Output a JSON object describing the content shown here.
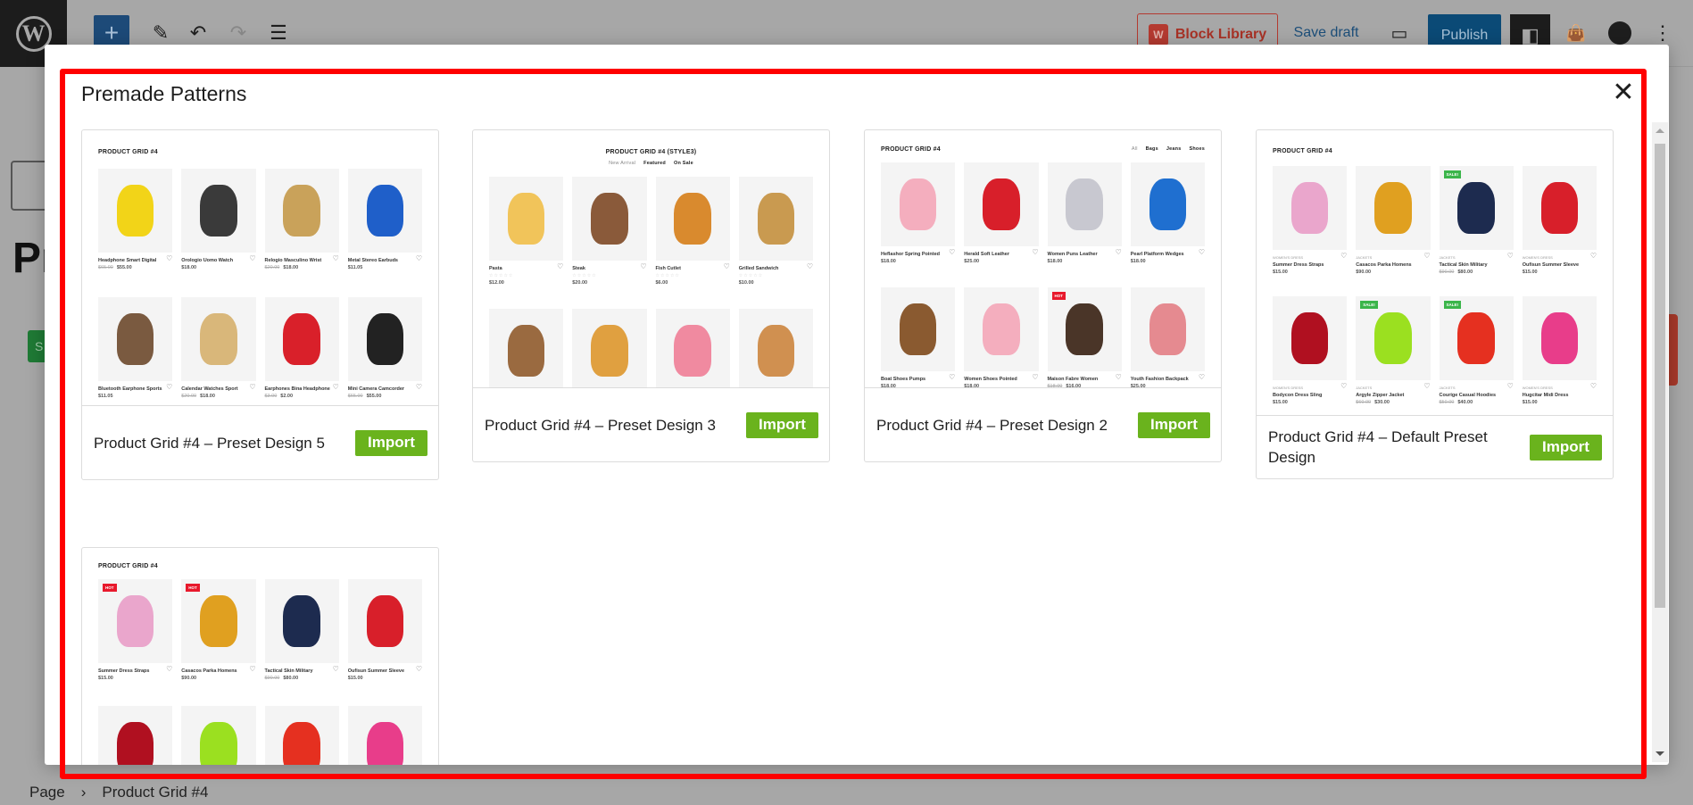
{
  "topbar": {
    "add_icon": "plus-icon",
    "block_library_label": "Block Library",
    "save_draft_label": "Save draft",
    "publish_label": "Publish"
  },
  "background": {
    "heading_fragment": "Pr",
    "green_button_fragment": "S"
  },
  "breadcrumb": {
    "items": [
      "Page",
      "Product Grid #4"
    ]
  },
  "modal": {
    "title": "Premade Patterns",
    "close_icon": "close-icon",
    "cards": [
      {
        "label": "Product Grid #4 – Preset Design 5",
        "import_label": "Import",
        "preview": {
          "heading": "PRODUCT GRID #4",
          "tabs": [],
          "stars": false,
          "products": [
            {
              "name": "Headphone Smart Digital",
              "old_price": "$65.00",
              "price": "$55.00",
              "color": "#f2d418"
            },
            {
              "name": "Orologio Uomo Watch",
              "price": "$18.00",
              "color": "#3a3a3a"
            },
            {
              "name": "Relogio Masculino Wrist",
              "old_price": "$20.00",
              "price": "$18.00",
              "color": "#c9a25a"
            },
            {
              "name": "Metal Stereo Earbuds",
              "price": "$11.05",
              "color": "#1f5fc9"
            },
            {
              "name": "Bluetooth Earphone Sports",
              "price": "$11.05",
              "color": "#7a5a40"
            },
            {
              "name": "Calendar Watches Sport",
              "old_price": "$20.00",
              "price": "$18.00",
              "color": "#d9b77a"
            },
            {
              "name": "Earphones Bina Headphone",
              "old_price": "$3.00",
              "price": "$2.00",
              "color": "#d9202a"
            },
            {
              "name": "Mini Camera Camcorder",
              "old_price": "$65.00",
              "price": "$55.00",
              "color": "#222222"
            }
          ]
        }
      },
      {
        "label": "Product Grid #4 – Preset Design 3",
        "import_label": "Import",
        "preview": {
          "heading": "PRODUCT GRID #4 (STYLE3)",
          "tabs": [
            "New Arrival",
            "Featured",
            "On Sale"
          ],
          "stars": true,
          "products": [
            {
              "name": "Pasta",
              "price": "$12.00",
              "color": "#f1c45a"
            },
            {
              "name": "Steak",
              "price": "$20.00",
              "color": "#8a5a3a"
            },
            {
              "name": "Fish Cutlet",
              "price": "$6.00",
              "color": "#d98a2e"
            },
            {
              "name": "Grilled Sandwich",
              "price": "$10.00",
              "color": "#c99a50"
            },
            {
              "name": "",
              "color": "#9a6a40"
            },
            {
              "name": "",
              "color": "#e0a040"
            },
            {
              "name": "",
              "color": "#f08aa0"
            },
            {
              "name": "",
              "color": "#d09050"
            }
          ]
        }
      },
      {
        "label": "Product Grid #4 – Preset Design 2",
        "import_label": "Import",
        "preview": {
          "heading": "PRODUCT GRID #4",
          "tabs": [
            "All",
            "Bags",
            "Jeans",
            "Shoes"
          ],
          "stars": false,
          "products": [
            {
              "name": "Heflashor Spring Pointed",
              "price": "$18.00",
              "color": "#f4aebe"
            },
            {
              "name": "Herald Soft Leather",
              "price": "$25.00",
              "color": "#d81f2a"
            },
            {
              "name": "Women Puns Leather",
              "price": "$18.00",
              "color": "#c8c8d0"
            },
            {
              "name": "Pearl Platform Wedges",
              "price": "$18.00",
              "color": "#1f6fd0"
            },
            {
              "name": "Boat Shoes Pumps",
              "price": "$18.00",
              "color": "#8a5a30"
            },
            {
              "name": "Women Shoes Pointed",
              "price": "$18.00",
              "color": "#f4aebe"
            },
            {
              "name": "Maison Fabre Women",
              "old_price": "$18.00",
              "price": "$16.00",
              "badge": "HOT",
              "badge_color": "#e8192c",
              "color": "#4a3528"
            },
            {
              "name": "Youth Fashion Backpack",
              "price": "$25.00",
              "color": "#e58a90"
            }
          ]
        }
      },
      {
        "label": "Product Grid #4 – Default Preset Design",
        "import_label": "Import",
        "preview": {
          "heading": "PRODUCT GRID #4",
          "tabs": [],
          "stars": false,
          "products": [
            {
              "category": "Women's Dress",
              "name": "Summer Dress Straps",
              "price": "$15.00",
              "color": "#eaa6cc"
            },
            {
              "category": "Jackets",
              "name": "Casacos Parka Homens",
              "price": "$90.00",
              "color": "#e0a020"
            },
            {
              "category": "Jackets",
              "name": "Tactical Skin Military",
              "old_price": "$90.00",
              "price": "$80.00",
              "badge": "SALE!",
              "badge_color": "#3bb54a",
              "color": "#1d2b4f"
            },
            {
              "category": "Women's Dress",
              "name": "Oufisun Summer Sleeve",
              "price": "$15.00",
              "color": "#d81f2a"
            },
            {
              "category": "Women's Dress",
              "name": "Bodycon Dress Sling",
              "price": "$15.00",
              "color": "#b01020"
            },
            {
              "category": "Jackets",
              "name": "Argyle Zipper Jacket",
              "old_price": "$60.00",
              "price": "$30.00",
              "badge": "SALE!",
              "badge_color": "#3bb54a",
              "color": "#9be020"
            },
            {
              "category": "Jackets",
              "name": "Courige Casual Hoodies",
              "old_price": "$50.00",
              "price": "$40.00",
              "badge": "SALE!",
              "badge_color": "#3bb54a",
              "color": "#e53020"
            },
            {
              "category": "Women's Dress",
              "name": "Hugcitar Midi Dress",
              "price": "$15.00",
              "color": "#e83d8a"
            }
          ]
        }
      },
      {
        "label": "",
        "import_label": "",
        "preview": {
          "heading": "PRODUCT GRID #4",
          "tabs": [],
          "stars": false,
          "products": [
            {
              "name": "Summer Dress Straps",
              "price": "$15.00",
              "badge": "HOT",
              "badge_color": "#e8192c",
              "color": "#eaa6cc"
            },
            {
              "name": "Casacos Parka Homens",
              "price": "$90.00",
              "badge": "HOT",
              "badge_color": "#e8192c",
              "color": "#e0a020"
            },
            {
              "name": "Tactical Skin Military",
              "old_price": "$90.00",
              "price": "$80.00",
              "color": "#1d2b4f"
            },
            {
              "name": "Oufisun Summer Sleeve",
              "price": "$15.00",
              "color": "#d81f2a"
            },
            {
              "name": "",
              "color": "#b01020"
            },
            {
              "name": "",
              "color": "#9be020"
            },
            {
              "name": "",
              "color": "#e53020"
            },
            {
              "name": "",
              "color": "#e83d8a"
            }
          ]
        }
      }
    ]
  },
  "colors": {
    "accent_import": "#6ab31d",
    "highlight_frame": "#ff0000",
    "publish": "#0b4a76"
  }
}
